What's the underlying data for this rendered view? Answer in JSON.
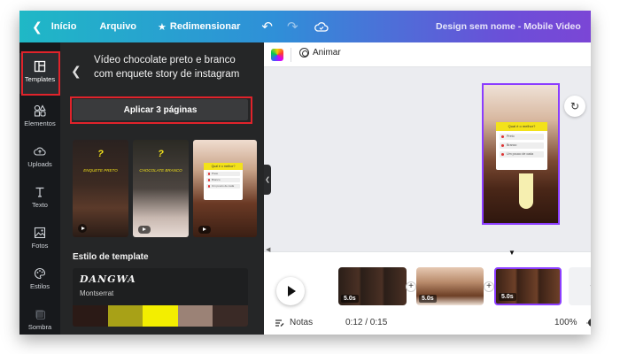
{
  "topbar": {
    "back_label": "Início",
    "file_label": "Arquivo",
    "resize_label": "Redimensionar",
    "title": "Design sem nome - Mobile Video"
  },
  "rail": {
    "items": [
      {
        "label": "Templates",
        "icon": "template-icon"
      },
      {
        "label": "Elementos",
        "icon": "shapes-icon"
      },
      {
        "label": "Uploads",
        "icon": "cloud-upload-icon"
      },
      {
        "label": "Texto",
        "icon": "text-icon"
      },
      {
        "label": "Fotos",
        "icon": "image-icon"
      },
      {
        "label": "Estilos",
        "icon": "palette-icon"
      },
      {
        "label": "Sombra",
        "icon": "shadow-icon"
      }
    ]
  },
  "panel": {
    "title": "Vídeo chocolate preto e branco com enquete story de instagram",
    "apply_label": "Aplicar 3 páginas",
    "thumbnails": [
      {
        "logo": "?",
        "caption": "ENQUETE PRETO"
      },
      {
        "logo": "?",
        "caption": "CHOCOLATE BRANCO"
      },
      {
        "poll_title": "Qual é o melhor?",
        "options": [
          "Preto",
          "Branco",
          "Um pouco de cada"
        ]
      }
    ],
    "style_section_title": "Estilo de template",
    "style": {
      "heading_font_name": "DANGWA",
      "body_font_name": "Montserrat",
      "swatches": [
        "#2b1a16",
        "#a8a117",
        "#f3ee00",
        "#9b8276",
        "#3a2a26"
      ]
    }
  },
  "editor": {
    "animate_label": "Animar",
    "canvas_poll": {
      "title": "Qual é o melhor?",
      "options": [
        "Preto",
        "Branco",
        "Um pouco de cada"
      ]
    }
  },
  "timeline": {
    "clips": [
      {
        "duration": "5.0s"
      },
      {
        "duration": "5.0s"
      },
      {
        "duration": "5.0s"
      }
    ],
    "add_page_symbol": "+",
    "notes_label": "Notas",
    "time": "0:12 / 0:15",
    "zoom": "100%"
  }
}
